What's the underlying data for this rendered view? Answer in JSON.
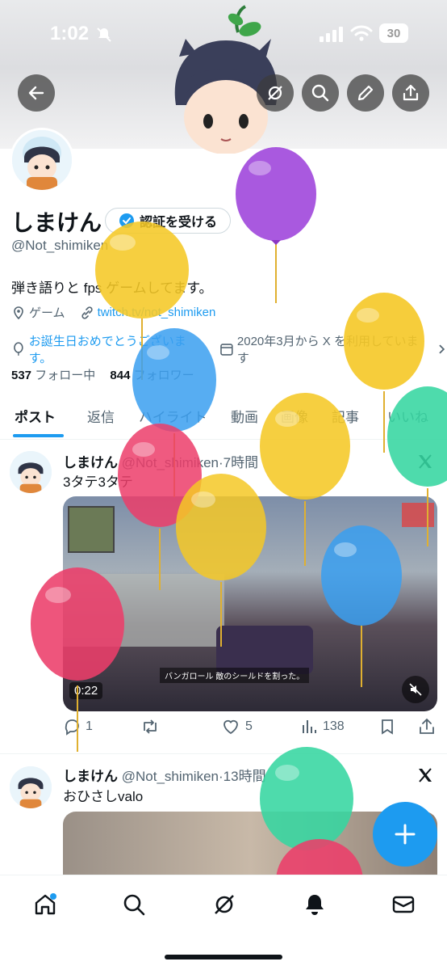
{
  "status_bar": {
    "time": "1:02",
    "battery": "30"
  },
  "profile": {
    "name": "しまけん",
    "verify_label": "認証を受ける",
    "handle": "@Not_shimiken",
    "bio": "弾き語りと fps ゲームしてます。",
    "category": "ゲーム",
    "website": "twitch.tv/not_shimiken",
    "birthday": "お誕生日おめでとうございます。",
    "joined": "2020年3月から X を利用しています",
    "following_count": "537",
    "following_label": "フォロー中",
    "followers_count": "844",
    "followers_label": "フォロワー"
  },
  "tabs": [
    "ポスト",
    "返信",
    "ハイライト",
    "動画",
    "画像",
    "記事",
    "いいね"
  ],
  "posts": [
    {
      "name": "しまけん",
      "handle": "@Not_shimiken",
      "time": "7時間",
      "text": "3タテ3タテ",
      "video_duration": "0:22",
      "game_hud_text": "バンガロール 敵のシールドを割った。",
      "replies": "1",
      "likes": "5",
      "views": "138"
    },
    {
      "name": "しまけん",
      "handle": "@Not_shimiken",
      "time": "13時間",
      "text": "おひさしvalo"
    }
  ],
  "colors": {
    "accent": "#1d9bf0",
    "balloon_purple": "#a24bdc",
    "balloon_yellow": "#f5c826",
    "balloon_blue": "#3a9ff0",
    "balloon_red": "#ec3d6a",
    "balloon_green": "#35d6a0"
  },
  "icons": [
    "back-icon",
    "grok-icon",
    "search-icon",
    "edit-icon",
    "share-icon",
    "home-icon",
    "explore-icon",
    "notifications-icon",
    "messages-icon",
    "x-logo-icon"
  ]
}
